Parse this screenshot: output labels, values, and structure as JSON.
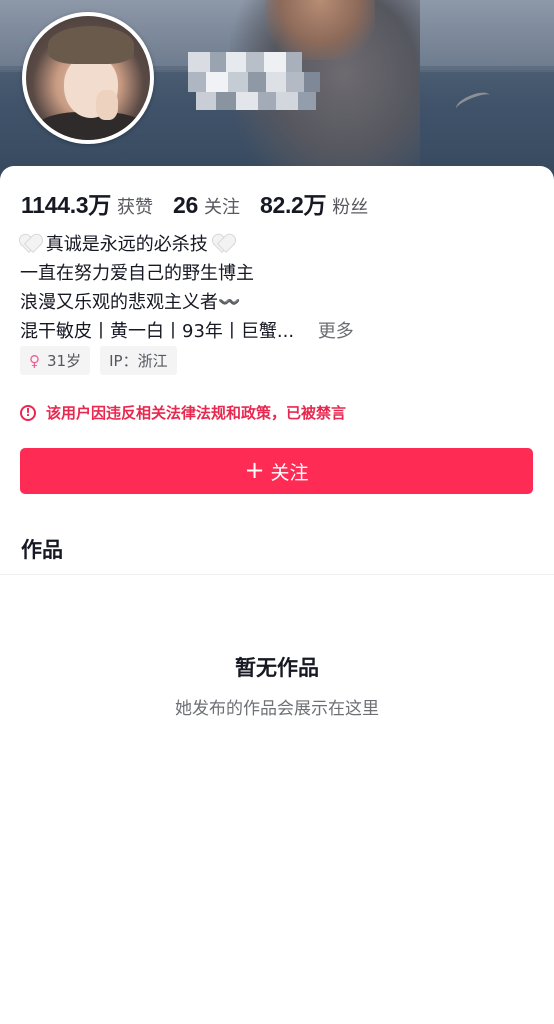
{
  "profile": {
    "stats": [
      {
        "value": "1144.3万",
        "label": "获赞"
      },
      {
        "value": "26",
        "label": "关注"
      },
      {
        "value": "82.2万",
        "label": "粉丝"
      }
    ],
    "bio": {
      "line1": "真诚是永远的必杀技",
      "line2": "一直在努力爱自己的野生博主",
      "line3": "浪漫又乐观的悲观主义者〰️",
      "line4": "混干敏皮丨黄一白丨93年丨巨蟹...",
      "more": "更多"
    },
    "tags": {
      "age": "31岁",
      "ip": "IP：浙江"
    },
    "ban_notice": "该用户因违反相关法律法规和政策，已被禁言",
    "follow_button": "关注"
  },
  "works": {
    "tab_label": "作品",
    "empty_title": "暂无作品",
    "empty_subtitle": "她发布的作品会展示在这里"
  },
  "colors": {
    "accent": "#fe2c55",
    "warning": "#e9284f"
  },
  "icons": {
    "gender": "female-icon",
    "ban": "alert-circle-icon",
    "follow": "plus-icon",
    "bio_heart": "white-heart-icon"
  }
}
